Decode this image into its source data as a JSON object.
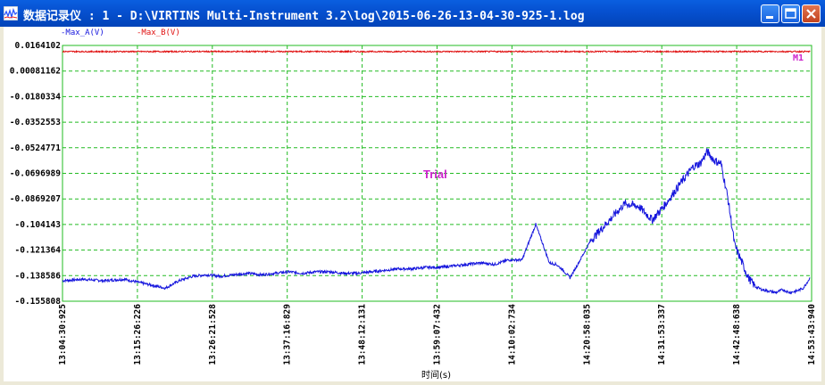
{
  "window": {
    "title": "数据记录仪 : 1 - D:\\VIRTINS Multi-Instrument 3.2\\log\\2015-06-26-13-04-30-925-1.log"
  },
  "colors": {
    "series_a": "#1515dd",
    "series_b": "#e01010",
    "grid": "#22bb22",
    "watermark": "#cc22cc",
    "marker": "#cc22cc"
  },
  "chart_data": {
    "type": "line",
    "xlabel": "时间(s)",
    "x_ticks": [
      "13:04:30:925",
      "13:15:26:226",
      "13:26:21:528",
      "13:37:16:829",
      "13:48:12:131",
      "13:59:07:432",
      "14:10:02:734",
      "14:20:58:035",
      "14:31:53:337",
      "14:42:48:638",
      "14:53:43:940"
    ],
    "x_range": [
      "13:04:30:925",
      "14:53:43:940"
    ],
    "y_ticks": [
      "0.0164102",
      "0.00081162",
      "-0.0180334",
      "-0.0352553",
      "-0.0524771",
      "-0.0696989",
      "-0.0869207",
      "-0.104143",
      "-0.121364",
      "-0.138586",
      "-0.155808"
    ],
    "ylim": [
      -0.155808,
      0.0164102
    ],
    "grid": true,
    "watermark": "Trial",
    "marker_label": "M1",
    "series": [
      {
        "name": "Max_A(V)",
        "x_minutes": [
          0,
          3,
          6,
          9,
          11,
          13,
          15,
          17,
          19,
          21,
          23,
          25,
          27,
          29,
          31,
          33,
          35,
          37,
          39,
          41,
          43,
          45,
          47,
          49,
          51,
          53,
          55,
          57,
          59,
          61,
          63,
          65,
          67,
          69,
          71,
          72,
          73,
          74,
          75,
          77,
          79,
          81,
          82,
          84,
          86,
          88,
          90,
          92,
          93,
          94,
          95,
          96,
          97,
          98,
          100,
          101,
          102,
          103,
          104,
          105,
          106,
          107,
          108,
          109
        ],
        "values": [
          -0.142,
          -0.141,
          -0.142,
          -0.141,
          -0.143,
          -0.145,
          -0.147,
          -0.142,
          -0.139,
          -0.138,
          -0.139,
          -0.138,
          -0.137,
          -0.138,
          -0.137,
          -0.136,
          -0.137,
          -0.136,
          -0.136,
          -0.137,
          -0.137,
          -0.136,
          -0.135,
          -0.134,
          -0.134,
          -0.133,
          -0.133,
          -0.132,
          -0.131,
          -0.13,
          -0.131,
          -0.128,
          -0.128,
          -0.104,
          -0.13,
          -0.131,
          -0.135,
          -0.14,
          -0.132,
          -0.115,
          -0.105,
          -0.095,
          -0.09,
          -0.092,
          -0.101,
          -0.09,
          -0.077,
          -0.065,
          -0.063,
          -0.055,
          -0.061,
          -0.063,
          -0.086,
          -0.118,
          -0.14,
          -0.146,
          -0.148,
          -0.149,
          -0.15,
          -0.148,
          -0.15,
          -0.149,
          -0.147,
          -0.14
        ]
      },
      {
        "name": "Max_B(V)",
        "x_minutes": [
          0,
          109
        ],
        "values": [
          0.0123,
          0.0123
        ]
      }
    ]
  }
}
